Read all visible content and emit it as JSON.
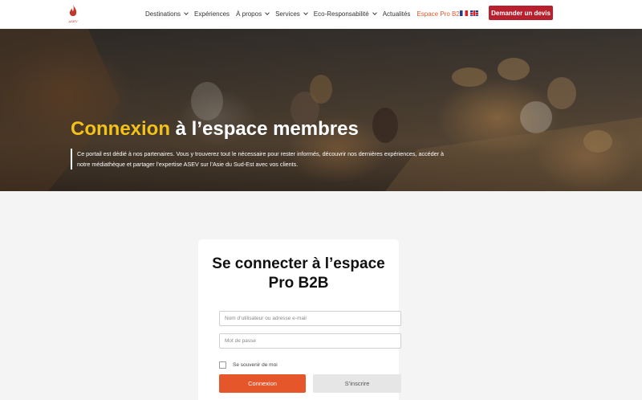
{
  "header": {
    "logo_text": "ASEV",
    "nav": [
      {
        "label": "Destinations",
        "dropdown": true
      },
      {
        "label": "Expériences",
        "dropdown": false
      },
      {
        "label": "À propos",
        "dropdown": true
      },
      {
        "label": "Services",
        "dropdown": true
      },
      {
        "label": "Eco-Responsabilité",
        "dropdown": true
      },
      {
        "label": "Actualités",
        "dropdown": false
      },
      {
        "label": "Espace Pro B2B",
        "dropdown": false,
        "active": true
      }
    ],
    "languages": [
      "fr",
      "en"
    ],
    "cta_label": "Demander un devis"
  },
  "hero": {
    "title_accent": "Connexion",
    "title_rest": " à l’espace membres",
    "description": "Ce portail est dédié à nos partenaires.  Vous y trouverez tout le nécessaire pour rester informés, découvrir nos dernières expériences, accéder à notre médiathèque et partager l’expertise ASEV sur l’Asie du Sud-Est avec vos clients."
  },
  "login": {
    "title": "Se connecter à l’espace Pro B2B",
    "username_placeholder": "Nom d’utilisateur ou adresse e-mail",
    "password_placeholder": "Mot de passe",
    "remember_label": "Se souvenir de moi",
    "login_button": "Connexion",
    "register_button": "S’inscrire"
  },
  "colors": {
    "brand_red": "#b8202e",
    "accent_orange": "#e5562a",
    "title_yellow": "#f2c21a"
  }
}
